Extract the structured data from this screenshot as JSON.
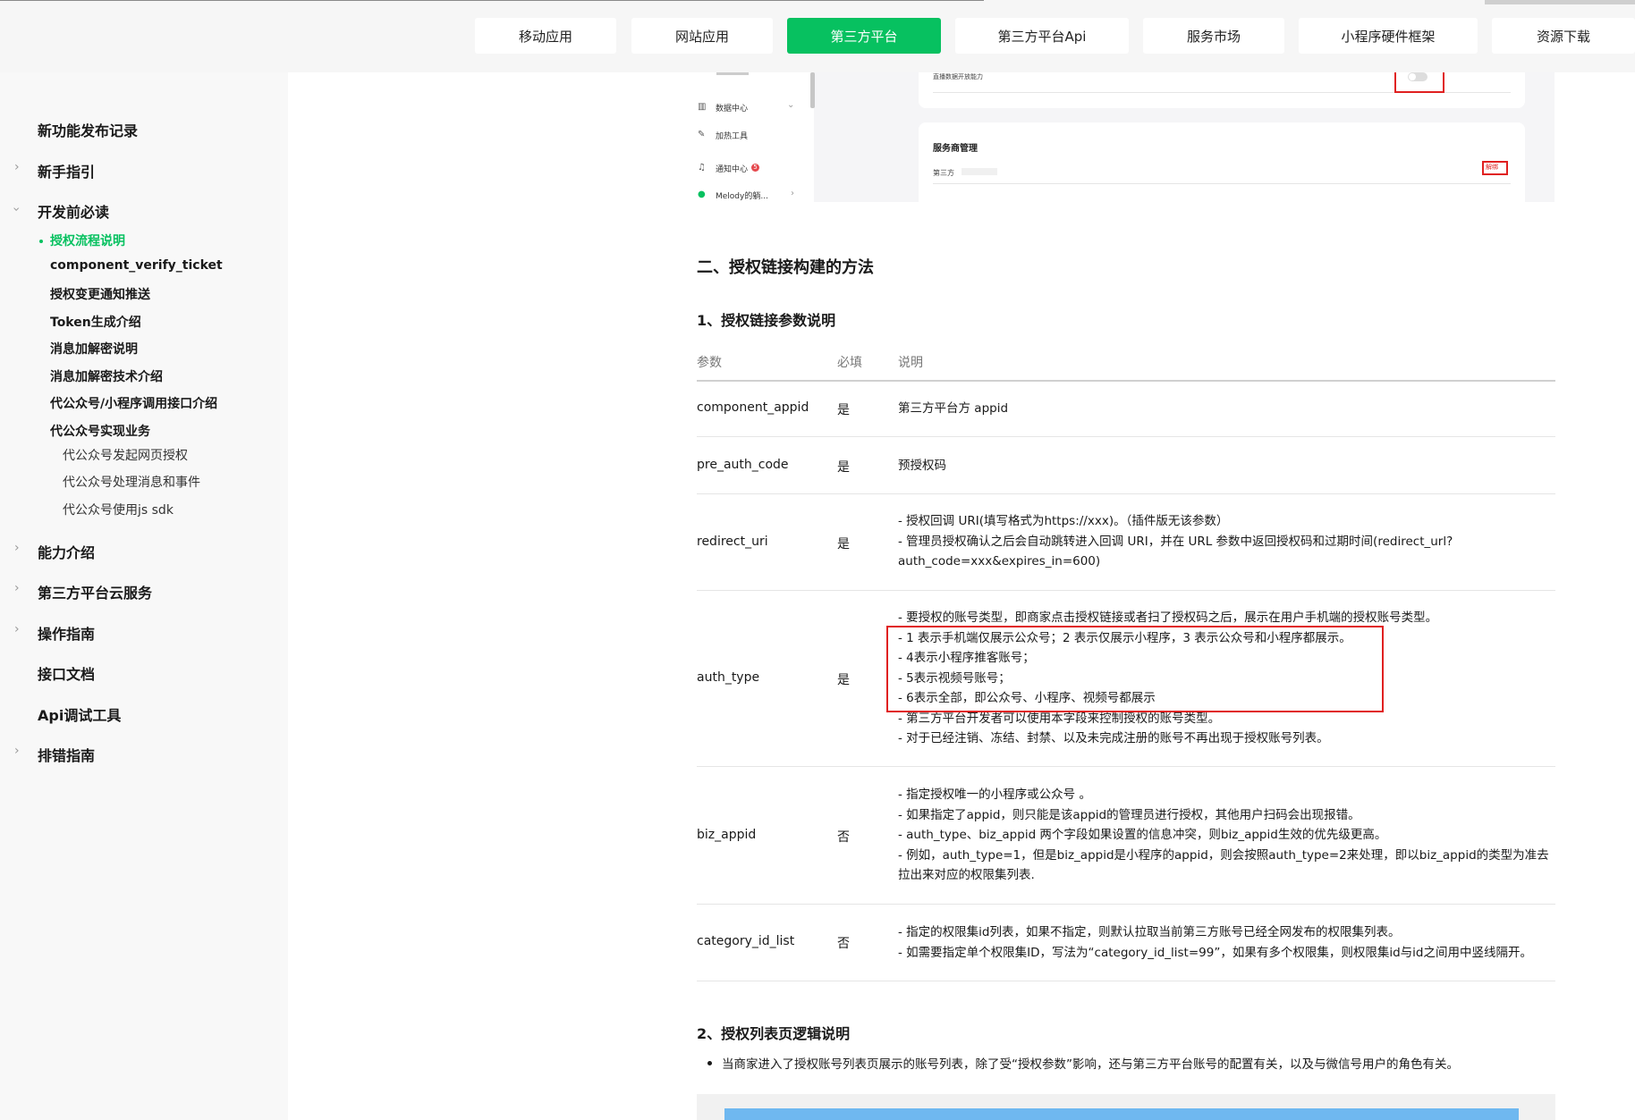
{
  "nav": {
    "tabs": [
      {
        "label": "移动应用",
        "active": false
      },
      {
        "label": "网站应用",
        "active": false
      },
      {
        "label": "第三方平台",
        "active": true
      },
      {
        "label": "第三方平台Api",
        "active": false
      },
      {
        "label": "服务市场",
        "active": false
      },
      {
        "label": "小程序硬件框架",
        "active": false
      },
      {
        "label": "资源下载",
        "active": false
      }
    ]
  },
  "sidebar": {
    "items": [
      {
        "label": "新功能发布记录"
      },
      {
        "label": "新手指引"
      },
      {
        "label": "开发前必读"
      },
      {
        "label": "能力介绍"
      },
      {
        "label": "第三方平台云服务"
      },
      {
        "label": "操作指南"
      },
      {
        "label": "接口文档"
      },
      {
        "label": "Api调试工具"
      },
      {
        "label": "排错指南"
      }
    ],
    "sub_items": [
      {
        "label": "授权流程说明",
        "active": true
      },
      {
        "label": "component_verify_ticket"
      },
      {
        "label": "授权变更通知推送"
      },
      {
        "label": "Token生成介绍"
      },
      {
        "label": "消息加解密说明"
      },
      {
        "label": "消息加解密技术介绍"
      },
      {
        "label": "代公众号/小程序调用接口介绍"
      },
      {
        "label": "代公众号实现业务"
      }
    ],
    "sub_sub_items": [
      {
        "label": "代公众号发起网页授权"
      },
      {
        "label": "代公众号处理消息和事件"
      },
      {
        "label": "代公众号使用js sdk"
      }
    ]
  },
  "screenshot": {
    "menu": [
      {
        "label": "数据中心"
      },
      {
        "label": "加热工具"
      },
      {
        "label": "通知中心"
      },
      {
        "label": "Melody的躺..."
      }
    ],
    "notify_badge": "5",
    "toggle_text": "直播数据开放能力",
    "card_title": "服务商管理",
    "row_label": "第三方",
    "action": "解绑"
  },
  "article": {
    "section_title": "二、授权链接构建的方法",
    "sub1_title": "1、授权链接参数说明",
    "table_headers": [
      "参数",
      "必填",
      "说明"
    ],
    "rows": [
      {
        "param": "component_appid",
        "required": "是",
        "desc": [
          "第三方平台方 appid"
        ]
      },
      {
        "param": "pre_auth_code",
        "required": "是",
        "desc": [
          "预授权码"
        ]
      },
      {
        "param": "redirect_uri",
        "required": "是",
        "desc": [
          "- 授权回调 URI(填写格式为https://xxx)。（插件版无该参数）",
          "- 管理员授权确认之后会自动跳转进入回调 URI，并在 URL 参数中返回授权码和过期时间(redirect_url?",
          "auth_code=xxx&expires_in=600)"
        ]
      },
      {
        "param": "auth_type",
        "required": "是",
        "desc": [
          "- 要授权的账号类型，即商家点击授权链接或者扫了授权码之后，展示在用户手机端的授权账号类型。",
          "- 1 表示手机端仅展示公众号；2 表示仅展示小程序，3 表示公众号和小程序都展示。",
          "- 4表示小程序推客账号；",
          "- 5表示视频号账号；",
          "- 6表示全部，即公众号、小程序、视频号都展示",
          "- 第三方平台开发者可以使用本字段来控制授权的账号类型。",
          "- 对于已经注销、冻结、封禁、以及未完成注册的账号不再出现于授权账号列表。"
        ]
      },
      {
        "param": "biz_appid",
        "required": "否",
        "desc": [
          "- 指定授权唯一的小程序或公众号 。",
          "- 如果指定了appid，则只能是该appid的管理员进行授权，其他用户扫码会出现报错。",
          "- auth_type、biz_appid 两个字段如果设置的信息冲突，则biz_appid生效的优先级更高。",
          "- 例如，auth_type=1，但是biz_appid是小程序的appid，则会按照auth_type=2来处理，即以biz_appid的类型为准去",
          "拉出来对应的权限集列表."
        ]
      },
      {
        "param": "category_id_list",
        "required": "否",
        "desc": [
          "- 指定的权限集id列表，如果不指定，则默认拉取当前第三方账号已经全网发布的权限集列表。",
          "- 如需要指定单个权限集ID，写法为“category_id_list=99”，如果有多个权限集，则权限集id与id之间用中竖线隔开。"
        ]
      }
    ],
    "sub2_title": "2、授权列表页逻辑说明",
    "bullet": "当商家进入了授权账号列表页展示的账号列表，除了受“授权参数”影响，还与第三方平台账号的配置有关，以及与微信号用户的角色有关。"
  }
}
